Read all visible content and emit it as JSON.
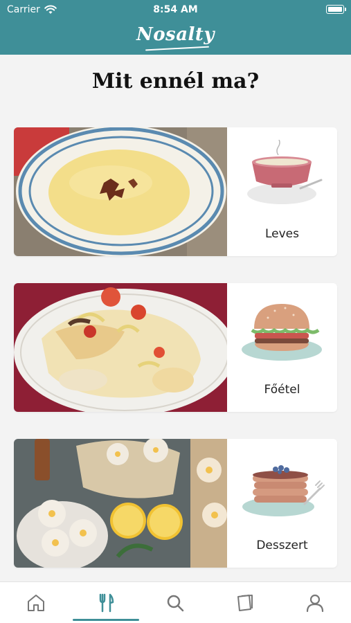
{
  "status_bar": {
    "carrier": "Carrier",
    "time": "8:54 AM"
  },
  "header": {
    "logo_text": "Nosalty"
  },
  "page": {
    "title": "Mit ennél ma?"
  },
  "categories": [
    {
      "label": "Leves",
      "icon": "soup-bowl-icon"
    },
    {
      "label": "Főétel",
      "icon": "burger-icon"
    },
    {
      "label": "Desszert",
      "icon": "pancakes-icon"
    }
  ],
  "tabbar": {
    "tabs": [
      {
        "icon": "home-icon"
      },
      {
        "icon": "fork-knife-icon",
        "selected": true
      },
      {
        "icon": "search-icon"
      },
      {
        "icon": "cards-icon"
      },
      {
        "icon": "profile-icon"
      }
    ],
    "accent_color": "#3f8f98"
  },
  "colors": {
    "header": "#3f8f98",
    "background": "#f3f3f3"
  }
}
